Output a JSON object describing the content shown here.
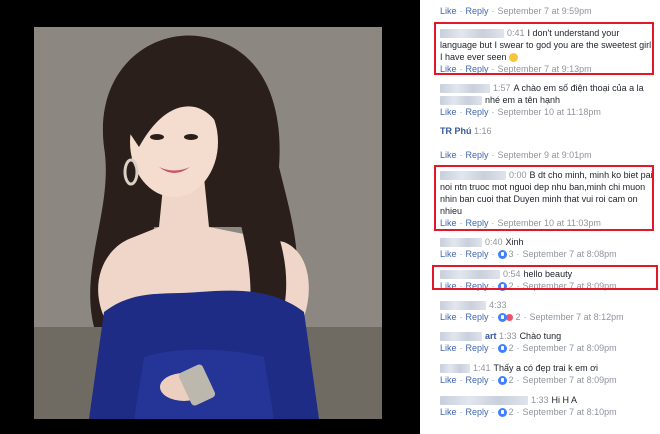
{
  "comments": [
    {
      "meta": {
        "like": "Like",
        "reply": "Reply",
        "date": "September 7 at 9:59pm"
      }
    },
    {
      "ts": "0:41",
      "text": "I don't understand your language but I swear to god you are the sweetest girl I have ever seen",
      "meta": {
        "like": "Like",
        "reply": "Reply",
        "date": "September 7 at 9:13pm"
      }
    },
    {
      "ts": "1:57",
      "text": "A chào em số điện thoại của a la",
      "text2": "nhé em a tên hạnh",
      "meta": {
        "like": "Like",
        "reply": "Reply",
        "date": "September 10 at 11:18pm"
      }
    },
    {
      "name": "TR Phú",
      "ts": "1:16",
      "meta": {
        "like": "Like",
        "reply": "Reply",
        "date": "September 9 at 9:01pm"
      }
    },
    {
      "ts": "0:00",
      "text": "B dt cho minh, minh ko biet pai noi ntn truoc mot nguoi dep nhu ban,minh chi muon nhin ban cuoi that Duyen minh that vui roi cam on nhieu",
      "meta": {
        "like": "Like",
        "reply": "Reply",
        "date": "September 10 at 11:03pm"
      }
    },
    {
      "ts": "0:40",
      "text": "Xinh",
      "meta": {
        "like": "Like",
        "reply": "Reply",
        "count": "3",
        "date": "September 7 at 8:08pm"
      }
    },
    {
      "ts": "0:54",
      "text": "hello beauty",
      "meta": {
        "like": "Like",
        "reply": "Reply",
        "count": "2",
        "date": "September 7 at 8:09pm"
      }
    },
    {
      "ts": "4:33",
      "meta": {
        "like": "Like",
        "reply": "Reply",
        "count": "2",
        "date": "September 7 at 8:12pm"
      }
    },
    {
      "name": "art",
      "ts": "1:33",
      "text": "Chào tung",
      "meta": {
        "like": "Like",
        "reply": "Reply",
        "count": "2",
        "date": "September 7 at 8:09pm"
      }
    },
    {
      "ts": "1:41",
      "text": "Thấy a có đẹp trai k em ơi",
      "meta": {
        "like": "Like",
        "reply": "Reply",
        "count": "2",
        "date": "September 7 at 8:09pm"
      }
    },
    {
      "ts": "1:33",
      "text": "Hi H A",
      "meta": {
        "like": "Like",
        "reply": "Reply",
        "count": "2",
        "date": "September 7 at 8:10pm"
      }
    }
  ]
}
